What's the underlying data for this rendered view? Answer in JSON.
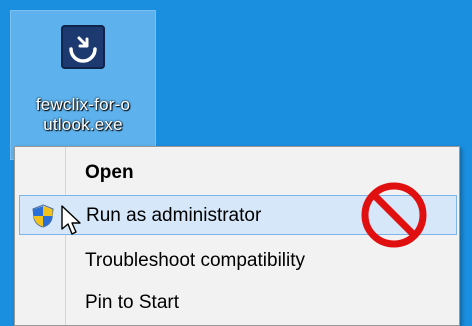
{
  "desktop": {
    "icon": {
      "name": "app-icon",
      "label_line1": "fewclix-for-o",
      "label_line2": "utlook.exe"
    }
  },
  "context_menu": {
    "items": [
      {
        "label": "Open",
        "bold": true
      },
      {
        "label": "Run as administrator",
        "icon": "uac-shield-icon",
        "highlighted": true
      },
      {
        "label": "Troubleshoot compatibility"
      },
      {
        "label": "Pin to Start"
      }
    ]
  },
  "overlay": {
    "prohibited_icon": "no-entry-icon",
    "prohibited_color": "#e01010",
    "cursor": "arrow-cursor"
  },
  "colors": {
    "desktop_bg": "#1a8fe0",
    "menu_bg": "#f2f2f2",
    "highlight_bg": "#d5e7f8",
    "highlight_border": "#7eb4ea"
  }
}
